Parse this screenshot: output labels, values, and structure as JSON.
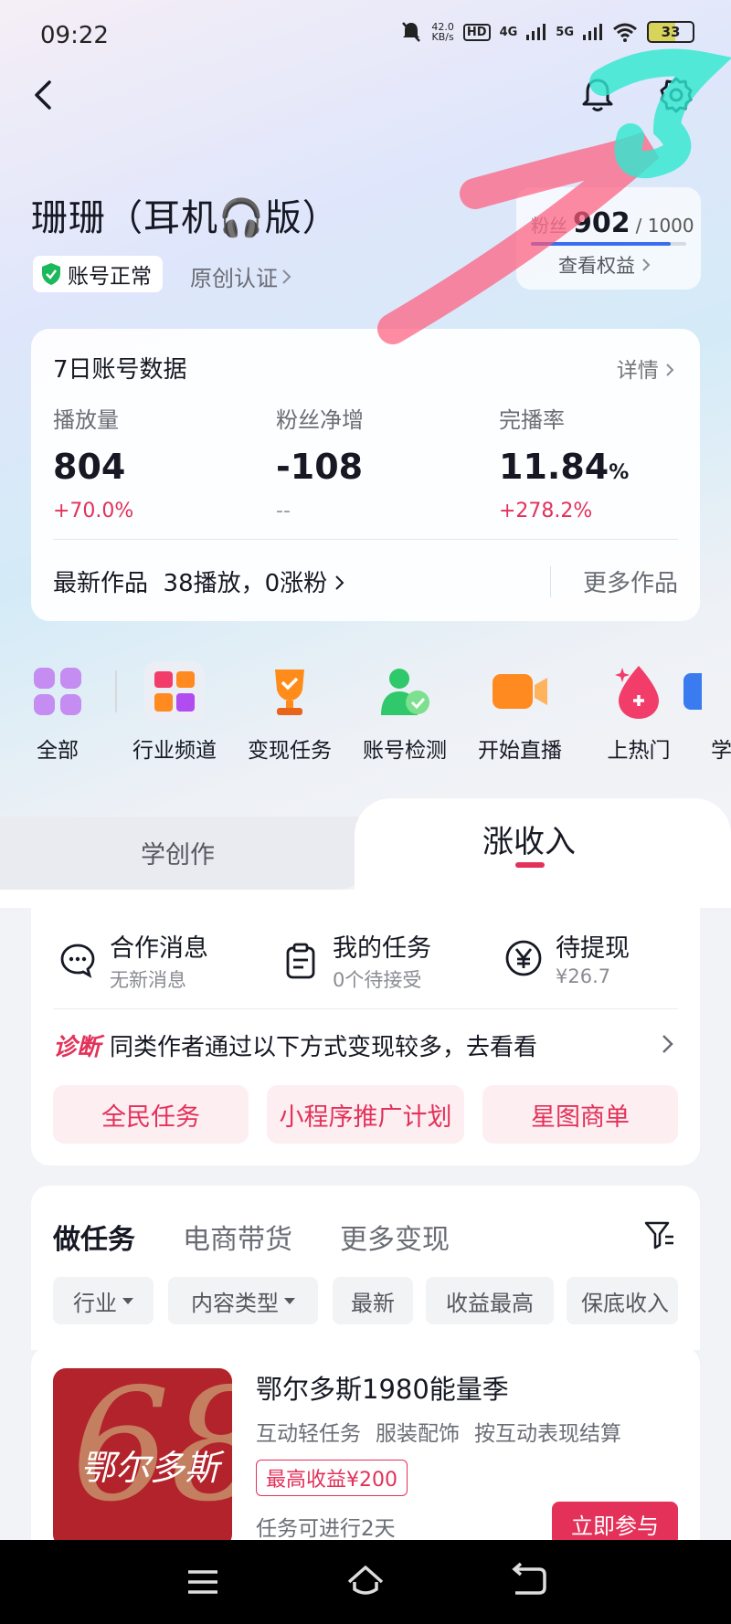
{
  "status_bar": {
    "time": "09:22",
    "net_speed_value": "42.0",
    "net_speed_unit": "KB/s",
    "hd": "HD",
    "signal_1": "4G",
    "signal_2": "5G",
    "battery": "33"
  },
  "profile": {
    "name": "珊珊（耳机🎧版）",
    "account_status": "账号正常",
    "original_cert": "原创认证"
  },
  "fans": {
    "label": "粉丝",
    "count": "902",
    "total": "/ 1000",
    "progress": 0.902,
    "rights_link": "查看权益"
  },
  "stats": {
    "title": "7日账号数据",
    "detail_link": "详情",
    "metrics": [
      {
        "label": "播放量",
        "value": "804",
        "unit": "",
        "change": "+70.0%"
      },
      {
        "label": "粉丝净增",
        "value": "-108",
        "unit": "",
        "change": "--"
      },
      {
        "label": "完播率",
        "value": "11.84",
        "unit": "%",
        "change": "+278.2%"
      }
    ],
    "latest_work": "最新作品  38播放，0涨粉",
    "more_works": "更多作品"
  },
  "tools": [
    {
      "label": "全部",
      "icon": "grid-icon"
    },
    {
      "label": "行业频道",
      "icon": "industry-channel-icon"
    },
    {
      "label": "变现任务",
      "icon": "trophy-icon"
    },
    {
      "label": "账号检测",
      "icon": "account-check-icon"
    },
    {
      "label": "开始直播",
      "icon": "video-camera-icon"
    },
    {
      "label": "上热门",
      "icon": "fire-drop-icon"
    },
    {
      "label": "学",
      "icon": "learn-icon"
    }
  ],
  "tabs": {
    "learn": "学创作",
    "earn": "涨收入"
  },
  "income": {
    "items": [
      {
        "title": "合作消息",
        "sub": "无新消息",
        "icon": "chat-bubble-icon"
      },
      {
        "title": "我的任务",
        "sub": "0个待接受",
        "icon": "clipboard-icon"
      },
      {
        "title": "待提现",
        "sub": "¥26.7",
        "icon": "yen-icon"
      }
    ],
    "diagnosis_tag": "诊断",
    "diagnosis_text": "同类作者通过以下方式变现较多，去看看",
    "pills": [
      "全民任务",
      "小程序推广计划",
      "星图商单"
    ]
  },
  "tasks": {
    "tabs": [
      "做任务",
      "电商带货",
      "更多变现"
    ],
    "filters": [
      {
        "label": "行业",
        "dropdown": true
      },
      {
        "label": "内容类型",
        "dropdown": true
      },
      {
        "label": "最新",
        "dropdown": false
      },
      {
        "label": "收益最高",
        "dropdown": false
      },
      {
        "label": "保底收入",
        "dropdown": false
      }
    ]
  },
  "campaign": {
    "brand": "鄂尔多斯",
    "brand_number": "68",
    "title": "鄂尔多斯1980能量季",
    "tags": [
      "互动轻任务",
      "服装配饰",
      "按互动表现结算"
    ],
    "max_earning": "最高收益¥200",
    "time_left": "任务可进行2天",
    "join_button": "立即参与"
  },
  "colors": {
    "accent": "#e3315a",
    "text": "#161823",
    "secondary": "#6b6d75"
  }
}
